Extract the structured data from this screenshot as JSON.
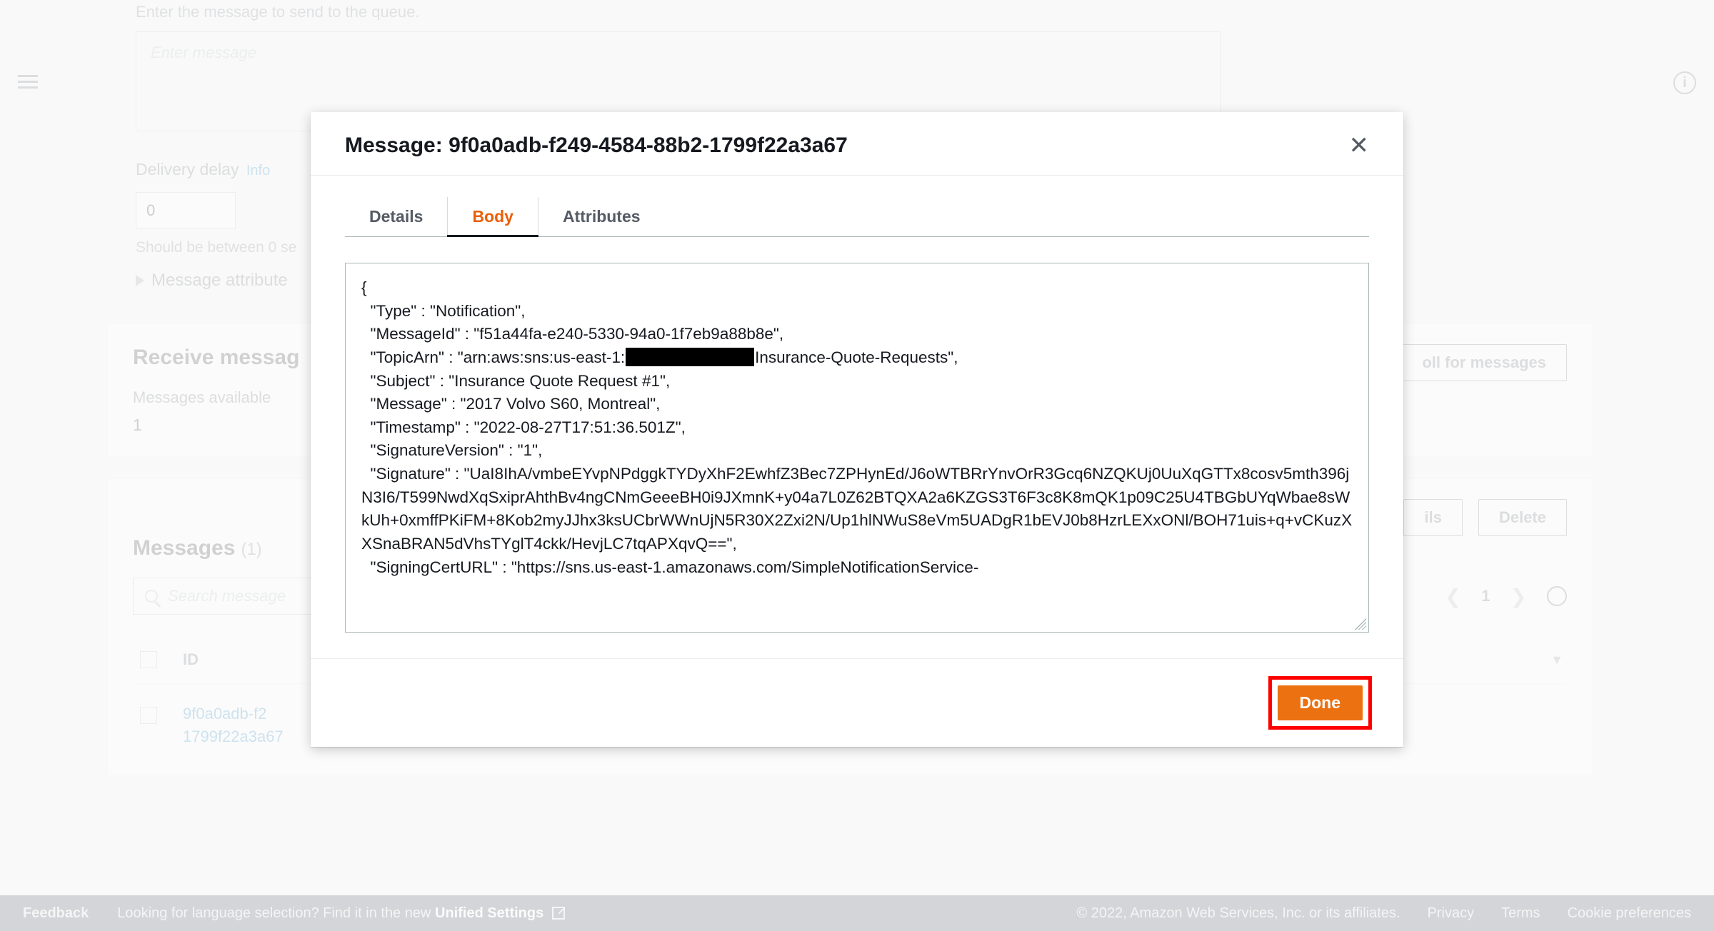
{
  "background": {
    "enter_msg_label": "Enter the message to send to the queue.",
    "msg_placeholder": "Enter message",
    "delivery_delay_label": "Delivery delay",
    "info_link": "Info",
    "delay_value": "0",
    "delay_note_prefix": "Should be between 0 se",
    "msg_attrs_label": "Message attribute",
    "receive_title_prefix": "Receive messag",
    "poll_btn": "oll for messages",
    "messages_available_label": "Messages available",
    "messages_available_value": "1",
    "messages_title": "Messages",
    "messages_count": "(1)",
    "btn_details_partial": "ils",
    "btn_delete": "Delete",
    "search_placeholder": "Search message",
    "page_number": "1",
    "id_col": "ID",
    "row_id_line1": "9f0a0adb-f2",
    "row_id_line2": "1799f22a3a67"
  },
  "modal": {
    "title_prefix": "Message: ",
    "message_id": "9f0a0adb-f249-4584-88b2-1799f22a3a67",
    "tabs": {
      "details": "Details",
      "body": "Body",
      "attributes": "Attributes"
    },
    "body_pre": "{\n  \"Type\" : \"Notification\",\n  \"MessageId\" : \"f51a44fa-e240-5330-94a0-1f7eb9a88b8e\",\n  \"TopicArn\" : \"arn:aws:sns:us-east-1:",
    "body_post": "Insurance-Quote-Requests\",\n  \"Subject\" : \"Insurance Quote Request #1\",\n  \"Message\" : \"2017 Volvo S60, Montreal\",\n  \"Timestamp\" : \"2022-08-27T17:51:36.501Z\",\n  \"SignatureVersion\" : \"1\",\n  \"Signature\" : \"UaI8IhA/vmbeEYvpNPdggkTYDyXhF2EwhfZ3Bec7ZPHynEd/J6oWTBRrYnvOrR3Gcq6NZQKUj0UuXqGTTx8cosv5mth396jN3I6/T599NwdXqSxiprAhthBv4ngCNmGeeeBH0i9JXmnK+y04a7L0Z62BTQXA2a6KZGS3T6F3c8K8mQK1p09C25U4TBGbUYqWbae8sWkUh+0xmffPKiFM+8Kob2myJJhx3ksUCbrWWnUjN5R30X2Zxi2N/Up1hlNWuS8eVm5UADgR1bEVJ0b8HzrLEXxONl/BOH71uis+q+vCKuzXXSnaBRAN5dVhsTYglT4ckk/HevjLC7tqAPXqvQ==\",\n  \"SigningCertURL\" : \"https://sns.us-east-1.amazonaws.com/SimpleNotificationService-",
    "done_btn": "Done"
  },
  "footer": {
    "feedback": "Feedback",
    "lang_text": "Looking for language selection? Find it in the new ",
    "unified_link": "Unified Settings",
    "copyright": "© 2022, Amazon Web Services, Inc. or its affiliates.",
    "privacy": "Privacy",
    "terms": "Terms",
    "cookies": "Cookie preferences"
  }
}
